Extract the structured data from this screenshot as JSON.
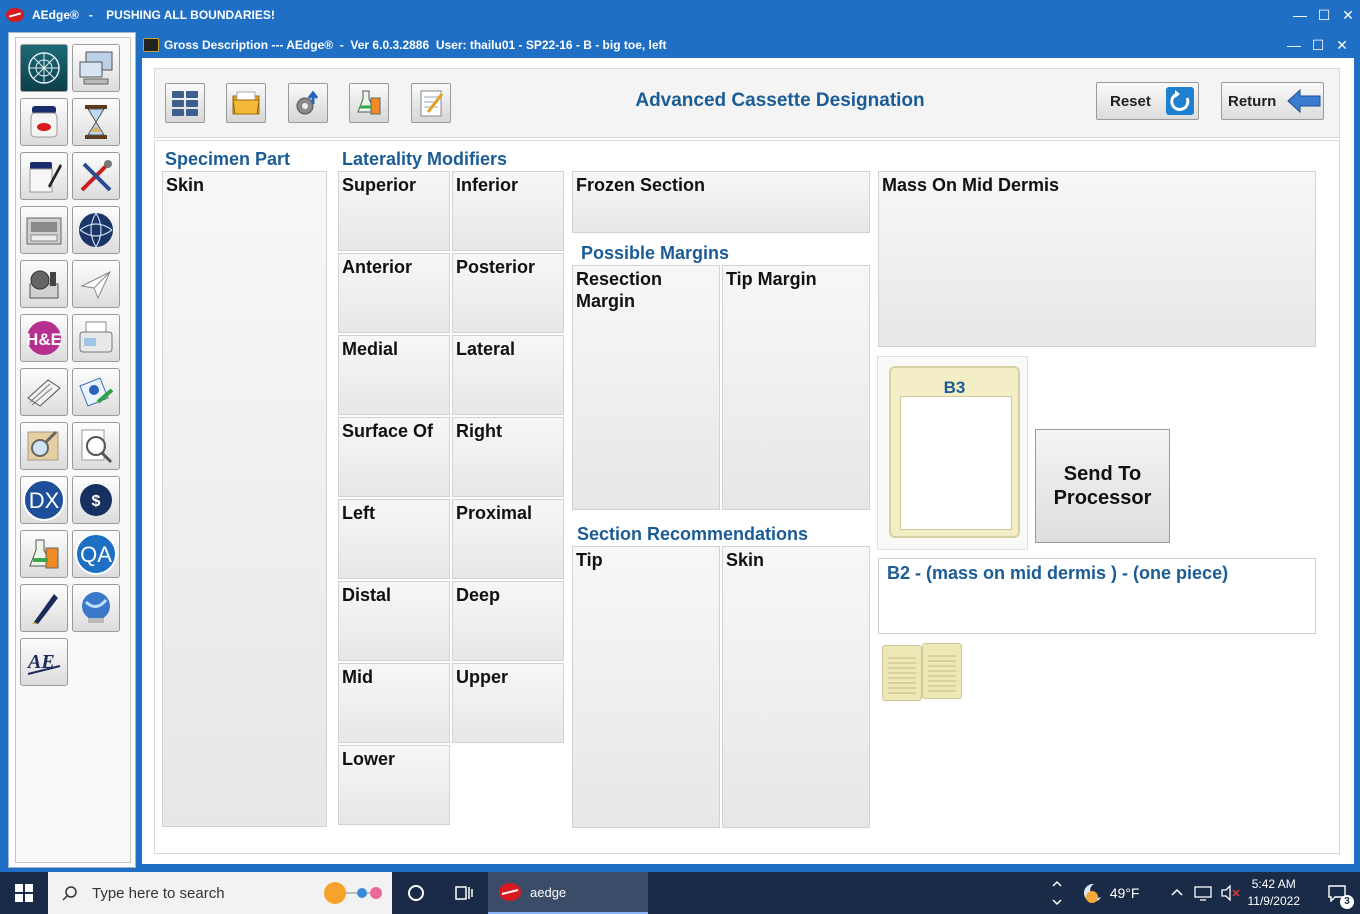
{
  "outer_window": {
    "title": "AEdge®   -    PUSHING ALL BOUNDARIES!",
    "controls": [
      "—",
      "☐",
      "✕"
    ]
  },
  "sidebar": {
    "tiles": [
      "network-icon",
      "computer-icon",
      "specimen-jar-icon",
      "hourglass-icon",
      "container-pen-icon",
      "tools-icon",
      "processor-icon",
      "globe-icon",
      "microtome-icon",
      "paper-plane-icon",
      "he-icon",
      "fax-icon",
      "slides-icon",
      "email-icon",
      "magnifier-icon",
      "document-search-icon",
      "dx-icon",
      "billing-icon",
      "lab-flask-icon",
      "qa-icon",
      "pen-icon",
      "web-icon",
      "aedge-logo-icon"
    ],
    "dx_label": "DX",
    "qa_label": "QA",
    "he_label": "H&E"
  },
  "inner_window": {
    "title": "Gross Description --- AEdge®  -  Ver 6.0.3.2886  User: thailu01 - SP22-16 - B - big toe, left",
    "controls": [
      "—",
      "☐",
      "✕"
    ]
  },
  "toolbar": {
    "buttons": [
      "grid-icon",
      "folder-icon",
      "settings-upload-icon",
      "lab-flask-icon",
      "notepad-icon"
    ],
    "page_title": "Advanced Cassette Designation",
    "reset_label": "Reset",
    "return_label": "Return"
  },
  "specimen_part": {
    "heading": "Specimen Part",
    "items": [
      "Skin"
    ]
  },
  "laterality": {
    "heading": "Laterality Modifiers",
    "items": [
      "Superior",
      "Inferior",
      "Anterior",
      "Posterior",
      "Medial",
      "Lateral",
      "Surface Of",
      "Right",
      "Left",
      "Proximal",
      "Distal",
      "Deep",
      "Mid",
      "Upper",
      "Lower"
    ]
  },
  "frozen_section": {
    "label": "Frozen Section"
  },
  "possible_margins": {
    "heading": "Possible Margins",
    "items": [
      "Resection Margin",
      "Tip Margin"
    ]
  },
  "section_recommendations": {
    "heading": "Section Recommendations",
    "items": [
      "Tip",
      "Skin"
    ]
  },
  "description": {
    "label": "Mass On Mid Dermis"
  },
  "cassette": {
    "label": "B3",
    "send_label": "Send To Processor",
    "summary": "B2 - (mass on mid dermis ) -  (one piece)",
    "existing_count": 2
  },
  "taskbar": {
    "search_placeholder": "Type here to search",
    "app_label": "aedge",
    "weather": "49°F",
    "time": "5:42 AM",
    "date": "11/9/2022",
    "notifications": "3"
  }
}
